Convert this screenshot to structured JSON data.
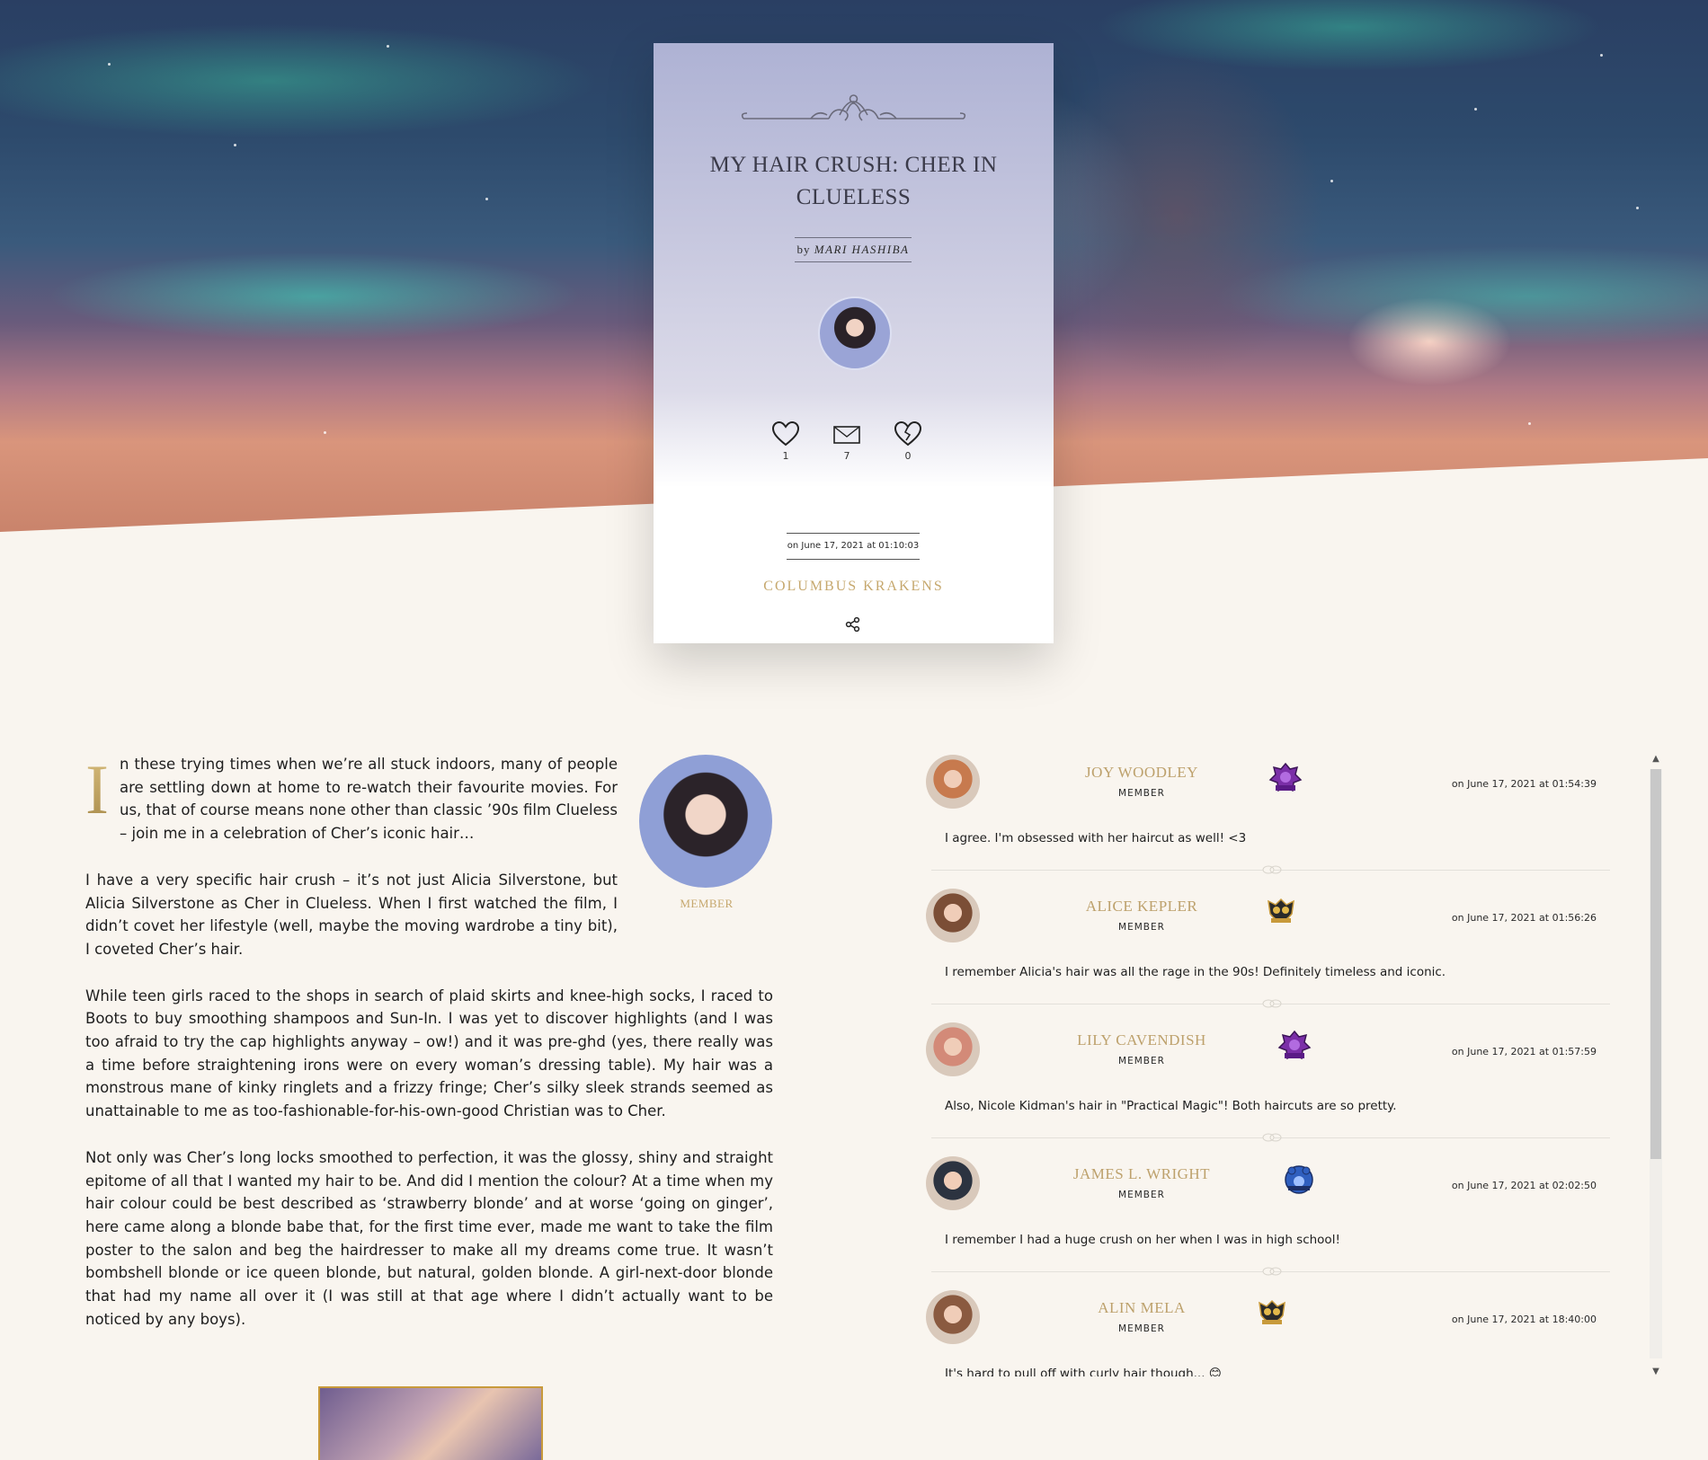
{
  "post": {
    "title": "MY HAIR CRUSH: CHER IN CLUELESS",
    "by_label": "by",
    "author": "MARI HASHIBA",
    "stats": [
      {
        "icon": "heart-icon",
        "count": "1"
      },
      {
        "icon": "envelope-icon",
        "count": "7"
      },
      {
        "icon": "broken-heart-icon",
        "count": "0"
      }
    ],
    "date": "on June 17, 2021 at 01:10:03",
    "team": "COLUMBUS KRAKENS"
  },
  "article": {
    "dropcap": "I",
    "p1": "n these trying times when we’re all stuck indoors, many of people are settling down at home to re-watch their favourite movies. For us, that of course means none other than classic ’90s film Clueless – join me in a celebration of Cher’s iconic hair…",
    "p2": "I have a very specific hair crush – it’s not just Alicia Silverstone, but Alicia Silverstone as Cher in Clueless. When I first watched the film, I didn’t covet her lifestyle (well, maybe the moving wardrobe a tiny bit), I coveted Cher’s hair.",
    "p3": "While teen girls raced to the shops in search of plaid skirts and knee-high socks, I raced to Boots to buy smoothing shampoos and Sun-In. I was yet to discover highlights (and I was too afraid to try the cap highlights anyway – ow!) and it was pre-ghd (yes, there really was a time before straightening irons were on every woman’s dressing table). My hair was a monstrous mane of kinky ringlets and a frizzy fringe; Cher’s silky sleek strands seemed as unattainable to me as too-fashionable-for-his-own-good Christian was to Cher.",
    "p4": "Not only was Cher’s long locks smoothed to perfection, it was the glossy, shiny and straight epitome of all that I wanted my hair to be. And did I mention the colour? At a time when my hair colour could be best described as ‘strawberry blonde’ and at worse ‘going on ginger’, here came along a blonde babe that, for the first time ever, made me want to take the film poster to the salon and beg the hairdresser to make all my dreams come true. It wasn’t bombshell blonde or ice queen blonde, but natural, golden blonde. A girl-next-door blonde that had my name all over it (I was still at that age where I didn’t actually want to be noticed by any boys).",
    "author_role": "MEMBER"
  },
  "comments": [
    {
      "name": "JOY WOODLEY",
      "role": "MEMBER",
      "team_logo": "krakens-logo",
      "time": "on June 17, 2021 at 01:54:39",
      "text": "I agree. I'm obsessed with her haircut as well! <3",
      "avatar_color": "#c77a4e"
    },
    {
      "name": "ALICE KEPLER",
      "role": "MEMBER",
      "team_logo": "owl-logo",
      "time": "on June 17, 2021 at 01:56:26",
      "text": "I remember Alicia's hair was all the rage in the 90s! Definitely timeless and iconic.",
      "avatar_color": "#7b4e36"
    },
    {
      "name": "LILY CAVENDISH",
      "role": "MEMBER",
      "team_logo": "krakens-logo",
      "time": "on June 17, 2021 at 01:57:59",
      "text": "Also, Nicole Kidman's hair in \"Practical Magic\"! Both haircuts are so pretty.",
      "avatar_color": "#d38a78"
    },
    {
      "name": "JAMES L. WRIGHT",
      "role": "MEMBER",
      "team_logo": "bear-logo",
      "time": "on June 17, 2021 at 02:02:50",
      "text": "I remember I had a huge crush on her when I was in high school!",
      "avatar_color": "#2c3340"
    },
    {
      "name": "ALIN MELA",
      "role": "MEMBER",
      "team_logo": "owl-logo",
      "time": "on June 17, 2021 at 18:40:00",
      "text": "It's hard to pull off with curly hair though... 😊",
      "avatar_color": "#8a5a40"
    }
  ],
  "colors": {
    "accent_gold": "#c6a86e",
    "background": "#f9f5ef"
  }
}
